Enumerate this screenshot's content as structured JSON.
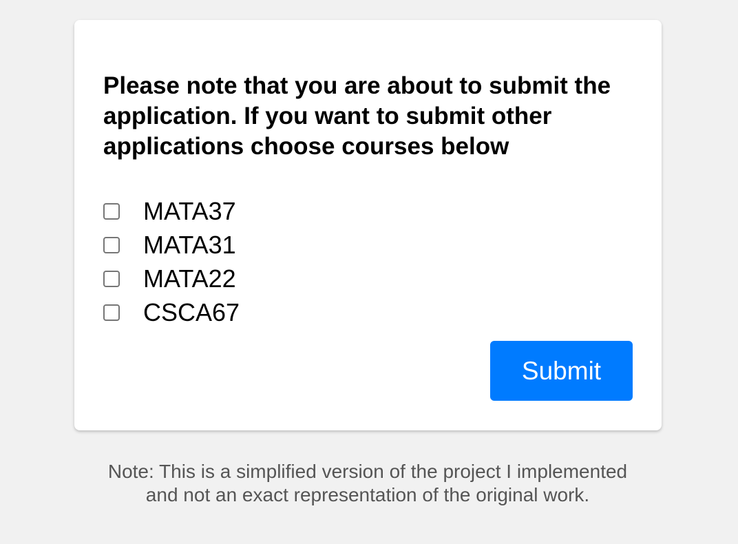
{
  "form": {
    "heading": "Please note that you are about to submit the application. If you want to submit other applications choose courses below",
    "courses": [
      {
        "label": "MATA37",
        "checked": false
      },
      {
        "label": "MATA31",
        "checked": false
      },
      {
        "label": "MATA22",
        "checked": false
      },
      {
        "label": "CSCA67",
        "checked": false
      }
    ],
    "submit_label": "Submit"
  },
  "footer": {
    "note_line1": "Note: This is a simplified version of the project I implemented",
    "note_line2": "and not an exact representation of the original work."
  },
  "colors": {
    "background": "#f1f1f1",
    "card": "#ffffff",
    "accent": "#007bff",
    "note_text": "#555555"
  }
}
